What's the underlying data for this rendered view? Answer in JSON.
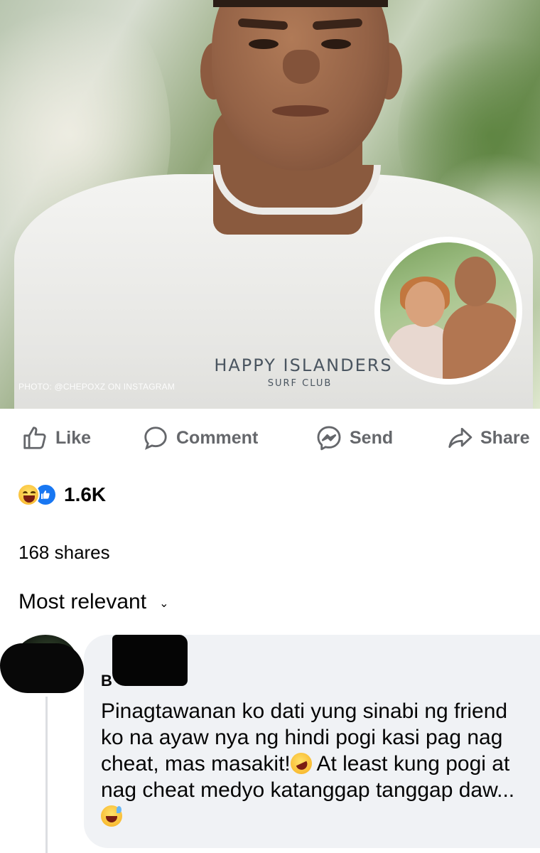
{
  "photo": {
    "shirt_line1": "HAPPY ISLANDERS",
    "shirt_line2": "SURF CLUB",
    "credit": "PHOTO: @CHEPOXZ ON INSTAGRAM"
  },
  "actions": {
    "like": "Like",
    "comment": "Comment",
    "send": "Send",
    "share": "Share"
  },
  "reactions": {
    "types": [
      "haha-emoji",
      "like-emoji"
    ],
    "count": "1.6K"
  },
  "shares": "168 shares",
  "sort": {
    "label": "Most relevant",
    "chevron": "⌄"
  },
  "comment": {
    "author_visible": "B",
    "text_parts": [
      "Pinagtawanan ko dati yung sinabi ng friend ko na ayaw nya ng hindi pogi kasi pag nag cheat, mas masakit!",
      " At least kung pogi at nag cheat medyo katanggap tanggap daw..."
    ],
    "emojis": [
      "rofl-emoji",
      "grinning-sweat-emoji"
    ]
  },
  "colors": {
    "action_gray": "#65676b",
    "facebook_blue": "#1877f2",
    "comment_bubble": "#f0f2f5"
  }
}
